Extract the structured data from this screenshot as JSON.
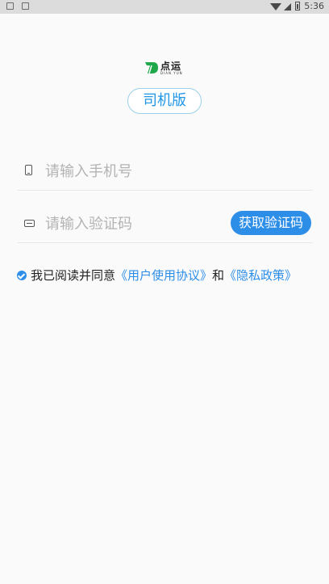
{
  "status_bar": {
    "time": "5:36"
  },
  "logo": {
    "text": "点运",
    "subtext": "DIAN YUN"
  },
  "version_label": "司机版",
  "form": {
    "phone_placeholder": "请输入手机号",
    "code_placeholder": "请输入验证码",
    "get_code_label": "获取验证码"
  },
  "agreement": {
    "prefix": "我已阅读并同意",
    "user_agreement": "《用户使用协议》",
    "conjunction": "和",
    "privacy_policy": "《隐私政策》"
  },
  "colors": {
    "accent": "#2d8ee8",
    "logo_green": "#1fa84a"
  }
}
